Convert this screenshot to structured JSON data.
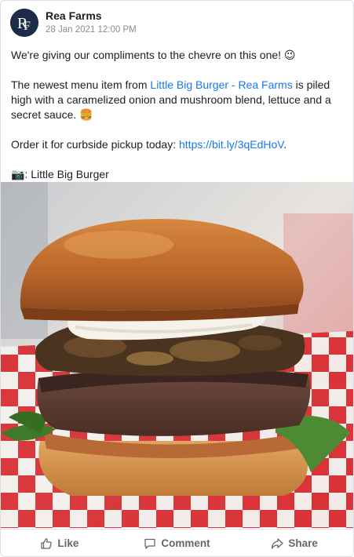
{
  "post": {
    "author": "Rea Farms",
    "avatar_monogram": "RF",
    "timestamp": "28 Jan 2021 12:00 PM",
    "line1": "We're giving our compliments to the chevre on this one! 😉",
    "para2_before": "The newest menu item from ",
    "para2_link": "Little Big Burger - Rea Farms",
    "para2_after": " is piled high with a caramelized onion and mushroom blend, lettuce and a secret sauce. 🍔",
    "para3_before": "Order it for curbside pickup today: ",
    "para3_link": "https://bit.ly/3qEdHoV",
    "para3_after": ".",
    "credit": "📷: Little Big Burger"
  },
  "actions": {
    "like_label": "Like",
    "comment_label": "Comment",
    "share_label": "Share"
  },
  "colors": {
    "link": "#1877f2",
    "avatar_bg": "#1b2b48",
    "action_text": "#65676b"
  },
  "icons": [
    "thumbs-up-icon",
    "comment-icon",
    "share-icon"
  ]
}
